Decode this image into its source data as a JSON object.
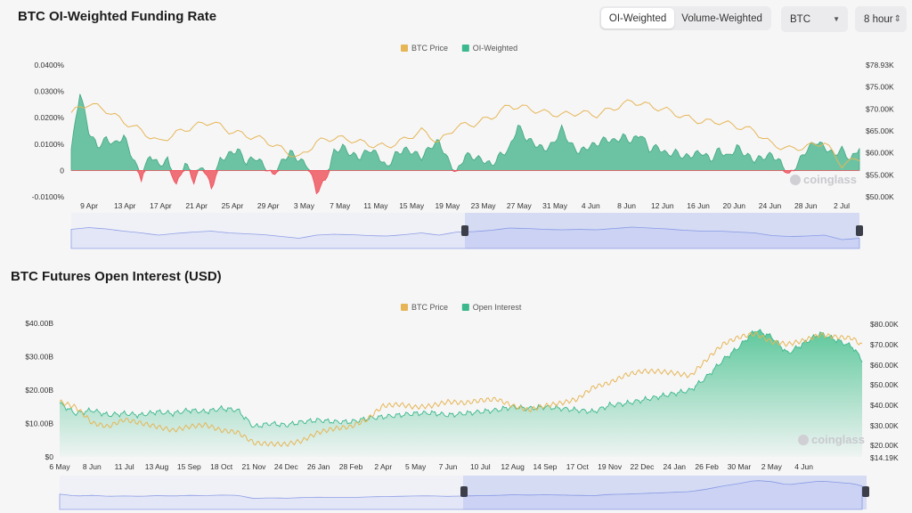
{
  "header": {
    "title": "BTC OI-Weighted Funding Rate",
    "toggle": [
      {
        "label": "OI-Weighted",
        "active": true
      },
      {
        "label": "Volume-Weighted",
        "active": false
      }
    ],
    "coin": "BTC",
    "interval": "8 hour"
  },
  "section2": {
    "title": "BTC Futures Open Interest (USD)"
  },
  "watermark": "coinglass",
  "colors": {
    "price": "#e6b656",
    "green": "#3bb88c",
    "red": "#ef4e59",
    "navigator": "#8e9ee6"
  },
  "chart_data": [
    {
      "type": "area",
      "legend": [
        "BTC Price",
        "OI-Weighted"
      ],
      "legend_position": "top-center",
      "y_left_ticks": [
        "0.0400%",
        "0.0300%",
        "0.0200%",
        "0.0100%",
        "0",
        "-0.0100%"
      ],
      "y_left_range": [
        -0.0001,
        0.0004
      ],
      "y_right_ticks": [
        "$78.93K",
        "$75.00K",
        "$70.00K",
        "$65.00K",
        "$60.00K",
        "$55.00K",
        "$50.00K"
      ],
      "y_right_range": [
        50000,
        78930
      ],
      "x_ticks": [
        "9 Apr",
        "13 Apr",
        "17 Apr",
        "21 Apr",
        "25 Apr",
        "29 Apr",
        "3 May",
        "7 May",
        "11 May",
        "15 May",
        "19 May",
        "23 May",
        "27 May",
        "31 May",
        "4 Jun",
        "8 Jun",
        "12 Jun",
        "16 Jun",
        "20 Jun",
        "24 Jun",
        "28 Jun",
        "2 Jul"
      ],
      "x_range_days": [
        0,
        90
      ],
      "series": [
        {
          "name": "OI-Weighted",
          "x": [
            0,
            1,
            2,
            3,
            4,
            5,
            6,
            7,
            8,
            9,
            10,
            11,
            12,
            13,
            14,
            15,
            16,
            17,
            18,
            19,
            20,
            21,
            22,
            23,
            24,
            25,
            26,
            27,
            28,
            29,
            30,
            31,
            32,
            33,
            34,
            35,
            36,
            37,
            38,
            39,
            40,
            41,
            42,
            43,
            44,
            45,
            46,
            47,
            48,
            49,
            50,
            51,
            52,
            53,
            54,
            55,
            56,
            57,
            58,
            59,
            60,
            61,
            62,
            63,
            64,
            65,
            66,
            67,
            68,
            69,
            70,
            71,
            72,
            73,
            74,
            75,
            76,
            77,
            78,
            79,
            80,
            81,
            82,
            83,
            84,
            85,
            86,
            87,
            88,
            89,
            90
          ],
          "values": [
            8e-05,
            0.0003,
            0.00015,
            9e-05,
            0.00012,
            0.0001,
            0.00013,
            5e-05,
            -3e-05,
            6e-05,
            2e-05,
            4e-05,
            -6e-05,
            3e-05,
            -4e-05,
            2e-05,
            -7e-05,
            4e-05,
            6e-05,
            8e-05,
            3e-05,
            5e-05,
            2e-05,
            -2e-05,
            3e-05,
            7e-05,
            4e-05,
            2e-05,
            -8e-05,
            -4e-05,
            7e-05,
            9e-05,
            6e-05,
            5e-05,
            8e-05,
            6e-05,
            1e-05,
            6e-05,
            8e-05,
            7e-05,
            5e-05,
            9e-05,
            0.00011,
            4e-05,
            -1e-05,
            6e-05,
            5e-05,
            4e-05,
            2e-05,
            6e-05,
            8e-05,
            0.00017,
            0.00012,
            0.0001,
            8e-05,
            0.0001,
            0.00016,
            0.0001,
            7e-05,
            9e-05,
            0.0001,
            0.00012,
            0.00011,
            0.00013,
            0.00011,
            0.00014,
            8e-05,
            9e-05,
            6e-05,
            7e-05,
            5e-05,
            6e-05,
            7e-05,
            4e-05,
            8e-05,
            5e-05,
            9e-05,
            6e-05,
            4e-05,
            5e-05,
            6e-05,
            3e-05,
            -2e-05,
            3e-05,
            8e-05,
            0.00011,
            9e-05,
            6e-05,
            8e-05,
            4e-05,
            9e-05
          ]
        },
        {
          "name": "BTC Price",
          "x": [
            0,
            2,
            4,
            6,
            8,
            10,
            12,
            14,
            16,
            18,
            20,
            22,
            24,
            26,
            28,
            30,
            32,
            34,
            36,
            38,
            40,
            42,
            44,
            46,
            48,
            50,
            52,
            54,
            56,
            58,
            60,
            62,
            64,
            66,
            68,
            70,
            72,
            74,
            76,
            78,
            80,
            82,
            84,
            86,
            88,
            90
          ],
          "values": [
            68500,
            70500,
            69000,
            66500,
            64500,
            62000,
            64000,
            65500,
            66500,
            64500,
            63500,
            62500,
            60500,
            58500,
            62000,
            63000,
            62500,
            61500,
            61000,
            62500,
            64500,
            62000,
            65500,
            66000,
            67500,
            70000,
            69500,
            68500,
            68000,
            68500,
            68000,
            69500,
            71000,
            70000,
            69000,
            67500,
            66500,
            66500,
            65500,
            64500,
            61500,
            60500,
            61000,
            62000,
            57000,
            58500
          ]
        }
      ],
      "navigator": {
        "type": "area",
        "selected_range": "right half"
      }
    },
    {
      "type": "area",
      "legend": [
        "BTC Price",
        "Open Interest"
      ],
      "legend_position": "top-center",
      "y_left_ticks": [
        "$40.00B",
        "$30.00B",
        "$20.00B",
        "$10.00B",
        "$0"
      ],
      "y_left_range": [
        0,
        40
      ],
      "y_right_ticks": [
        "$80.00K",
        "$70.00K",
        "$60.00K",
        "$50.00K",
        "$40.00K",
        "$30.00K",
        "$20.00K",
        "$14.19K"
      ],
      "y_right_scale": "log",
      "y_right_range": [
        14190,
        80000
      ],
      "x_ticks": [
        "6 May",
        "8 Jun",
        "11 Jul",
        "13 Aug",
        "15 Sep",
        "18 Oct",
        "21 Nov",
        "24 Dec",
        "26 Jan",
        "28 Feb",
        "2 Apr",
        "5 May",
        "7 Jun",
        "10 Jul",
        "12 Aug",
        "14 Sep",
        "17 Oct",
        "19 Nov",
        "22 Dec",
        "24 Jan",
        "26 Feb",
        "30 Mar",
        "2 May",
        "4 Jun"
      ],
      "x_range_index": [
        0,
        24.8
      ],
      "series": [
        {
          "name": "Open Interest",
          "x": [
            0,
            0.5,
            1,
            1.5,
            2,
            2.5,
            3,
            3.5,
            4,
            4.5,
            5,
            5.5,
            6,
            6.5,
            7,
            7.5,
            8,
            8.5,
            9,
            9.5,
            10,
            10.5,
            11,
            11.5,
            12,
            12.5,
            13,
            13.5,
            14,
            14.5,
            15,
            15.5,
            16,
            16.5,
            17,
            17.5,
            18,
            18.5,
            19,
            19.5,
            20,
            20.5,
            21,
            21.5,
            22,
            22.5,
            23,
            23.5,
            24,
            24.5,
            24.8
          ],
          "values": [
            16,
            13,
            14,
            12.5,
            13,
            12.5,
            13.5,
            13,
            14,
            13.5,
            14.5,
            14,
            9,
            10,
            9.5,
            10.5,
            11,
            10.5,
            10.5,
            11.5,
            12,
            12.5,
            13,
            13.2,
            12.5,
            13,
            13.5,
            14,
            15,
            14.5,
            15,
            14.5,
            14,
            13.5,
            15.5,
            16,
            17,
            18,
            19,
            20,
            24,
            29,
            33,
            38,
            36,
            31,
            34,
            37,
            35,
            33,
            29
          ]
        },
        {
          "name": "BTC Price",
          "x": [
            0,
            0.5,
            1,
            1.5,
            2,
            2.5,
            3,
            3.5,
            4,
            4.5,
            5,
            5.5,
            6,
            6.5,
            7,
            7.5,
            8,
            8.5,
            9,
            9.5,
            10,
            10.5,
            11,
            11.5,
            12,
            12.5,
            13,
            13.5,
            14,
            14.5,
            15,
            15.5,
            16,
            16.5,
            17,
            17.5,
            18,
            18.5,
            19,
            19.5,
            20,
            20.5,
            21,
            21.5,
            22,
            22.5,
            23,
            23.5,
            24,
            24.5,
            24.8
          ],
          "values": [
            29000,
            27000,
            22000,
            21000,
            23000,
            22000,
            21000,
            20000,
            21000,
            21500,
            20000,
            19500,
            17000,
            16800,
            16700,
            17500,
            19500,
            20500,
            21000,
            23000,
            27500,
            28000,
            27000,
            27500,
            29000,
            28500,
            29500,
            30000,
            27500,
            26000,
            27500,
            28500,
            30000,
            35000,
            37000,
            41000,
            43000,
            43000,
            42000,
            40500,
            50000,
            61000,
            67000,
            70000,
            63000,
            61000,
            64000,
            69000,
            67000,
            66000,
            60000
          ]
        }
      ],
      "navigator": {
        "type": "area",
        "selected_range": "right half"
      }
    }
  ]
}
